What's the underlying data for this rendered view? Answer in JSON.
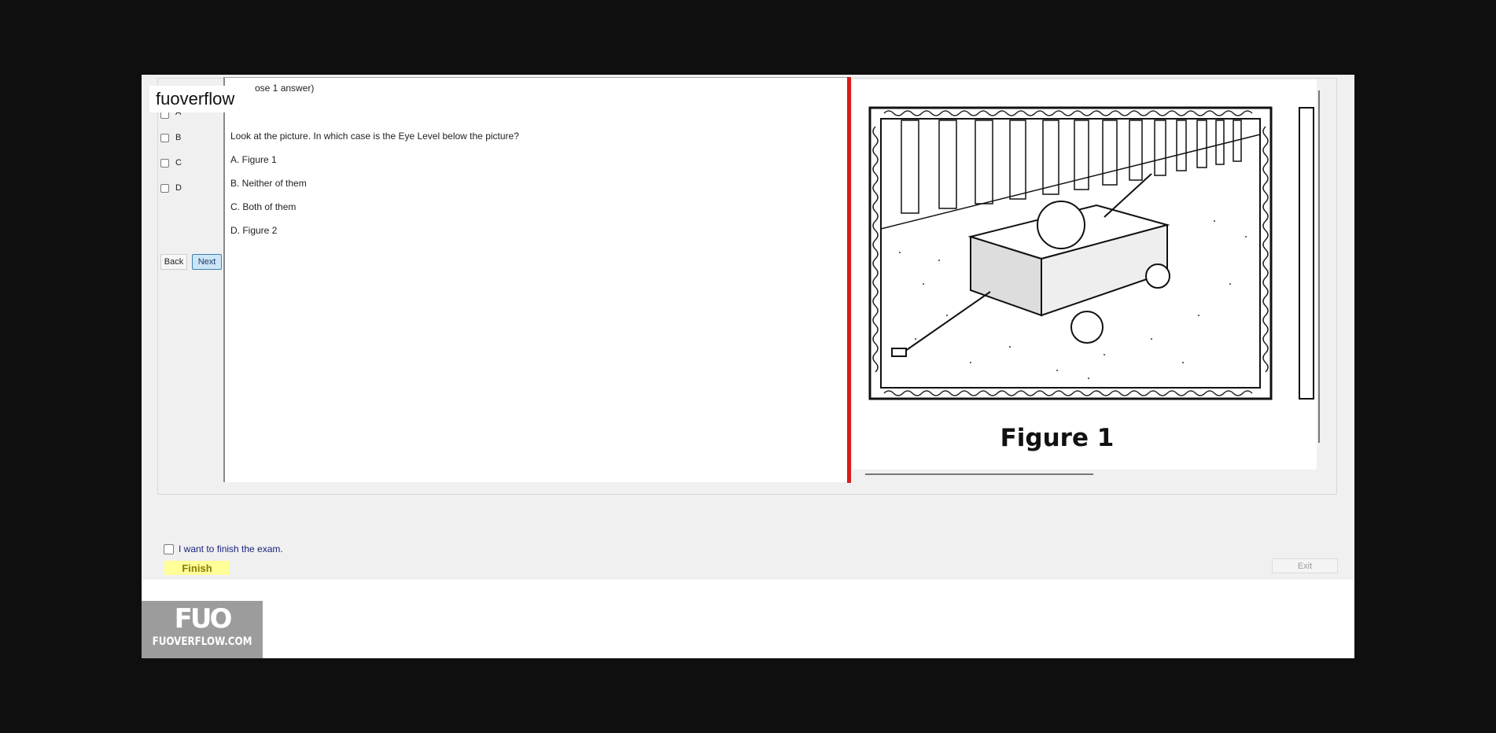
{
  "watermark": {
    "text": "fuoverflow"
  },
  "answer_choices": [
    "B",
    "C",
    "D"
  ],
  "answer_choice_partial": "A",
  "nav": {
    "back_label": "Back",
    "next_label": "Next"
  },
  "question": {
    "instruction_partial": "ose 1 answer)",
    "prompt": "Look at the picture. In which case is the Eye Level below the picture?",
    "options": [
      "A.  Figure 1",
      "B.  Neither of them",
      "C.  Both of them",
      "D.  Figure 2"
    ]
  },
  "figure": {
    "caption": "Figure 1"
  },
  "footer": {
    "finish_checkbox_label": "I want to finish the exam.",
    "finish_label": "Finish",
    "exit_label": "Exit"
  },
  "brand": {
    "logo_big": "FUO",
    "logo_small": "FUOVERFLOW.COM"
  },
  "colors": {
    "accent_divider": "#d81b1b",
    "next_button": "#cde6f7",
    "finish_button": "#ffff9a"
  }
}
